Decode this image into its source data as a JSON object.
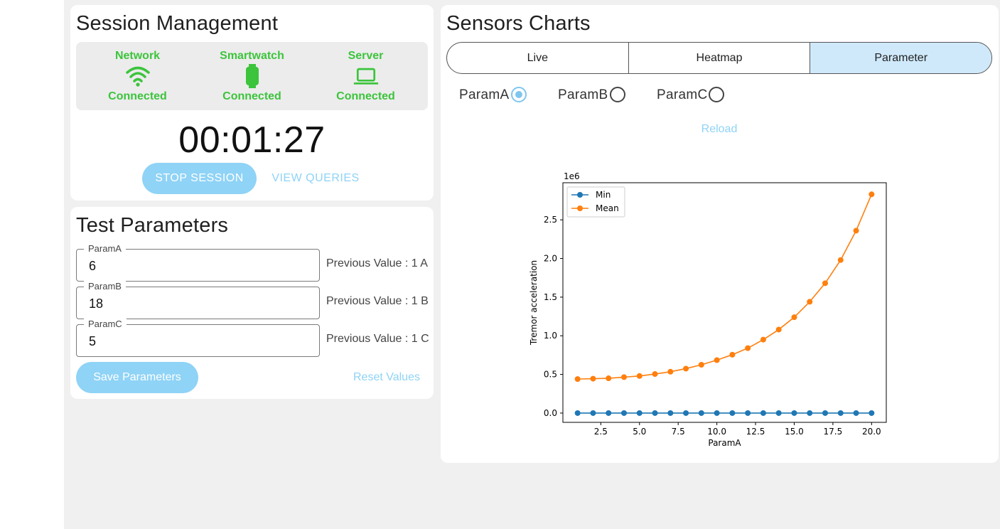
{
  "session": {
    "title": "Session Management",
    "status": [
      {
        "name": "Network",
        "state": "Connected",
        "icon": "wifi-icon"
      },
      {
        "name": "Smartwatch",
        "state": "Connected",
        "icon": "smartwatch-icon"
      },
      {
        "name": "Server",
        "state": "Connected",
        "icon": "laptop-icon"
      }
    ],
    "timer": "00:01:27",
    "stop_label": "STOP SESSION",
    "queries_label": "VIEW QUERIES"
  },
  "params": {
    "title": "Test Parameters",
    "fields": [
      {
        "label": "ParamA",
        "value": "6",
        "previous": "Previous Value : 1  A"
      },
      {
        "label": "ParamB",
        "value": "18",
        "previous": "Previous Value : 1  B"
      },
      {
        "label": "ParamC",
        "value": "5",
        "previous": "Previous Value : 1  C"
      }
    ],
    "save_label": "Save Parameters",
    "reset_label": "Reset Values"
  },
  "charts": {
    "title": "Sensors Charts",
    "tabs": [
      "Live",
      "Heatmap",
      "Parameter"
    ],
    "active_tab": "Parameter",
    "radios": [
      {
        "label": "ParamA",
        "checked": true
      },
      {
        "label": "ParamB",
        "checked": false
      },
      {
        "label": "ParamC",
        "checked": false
      }
    ],
    "reload_label": "Reload"
  },
  "colors": {
    "accent": "#8fd3f6",
    "status_green": "#3cc43c",
    "series_min": "#1f77b4",
    "series_mean": "#ff7f0e"
  },
  "chart_data": {
    "type": "line",
    "xlabel": "ParamA",
    "ylabel": "Tremor acceleration",
    "y_scale_label": "1e6",
    "xlim": [
      0.05,
      20.95
    ],
    "ylim": [
      -0.12,
      2.98
    ],
    "x_ticks": [
      2.5,
      5.0,
      7.5,
      10.0,
      12.5,
      15.0,
      17.5,
      20.0
    ],
    "x_tick_labels": [
      "2.5",
      "5.0",
      "7.5",
      "10.0",
      "12.5",
      "15.0",
      "17.5",
      "20.0"
    ],
    "y_ticks": [
      0.0,
      0.5,
      1.0,
      1.5,
      2.0,
      2.5
    ],
    "y_tick_labels": [
      "0.0",
      "0.5",
      "1.0",
      "1.5",
      "2.0",
      "2.5"
    ],
    "legend_position": "top-left",
    "x": [
      1,
      2,
      3,
      4,
      5,
      6,
      7,
      8,
      9,
      10,
      11,
      12,
      13,
      14,
      15,
      16,
      17,
      18,
      19,
      20
    ],
    "series": [
      {
        "name": "Min",
        "color": "#1f77b4",
        "values": [
          0,
          0,
          0,
          0,
          0,
          0,
          0,
          0,
          0,
          0,
          0,
          0,
          0,
          0,
          0,
          0,
          0,
          0,
          0,
          0
        ]
      },
      {
        "name": "Mean",
        "color": "#ff7f0e",
        "values": [
          0.44,
          0.445,
          0.45,
          0.465,
          0.48,
          0.505,
          0.535,
          0.575,
          0.625,
          0.685,
          0.755,
          0.84,
          0.95,
          1.08,
          1.24,
          1.44,
          1.68,
          1.98,
          2.36,
          2.83
        ]
      }
    ]
  }
}
